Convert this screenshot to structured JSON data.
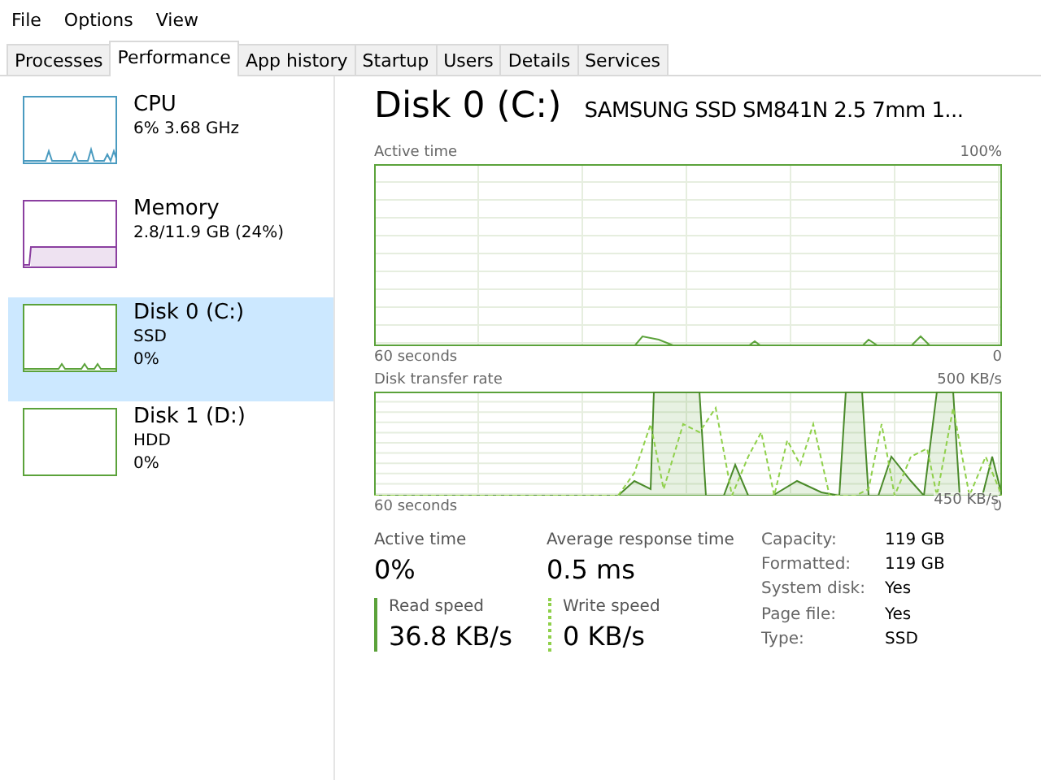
{
  "menu": [
    "File",
    "Options",
    "View"
  ],
  "tabs": [
    {
      "label": "Processes",
      "selected": false
    },
    {
      "label": "Performance",
      "selected": true
    },
    {
      "label": "App history",
      "selected": false
    },
    {
      "label": "Startup",
      "selected": false
    },
    {
      "label": "Users",
      "selected": false
    },
    {
      "label": "Details",
      "selected": false
    },
    {
      "label": "Services",
      "selected": false
    }
  ],
  "sidebar": {
    "items": [
      {
        "kind": "cpu",
        "name": "CPU",
        "lines": [
          "6% 3.68 GHz"
        ],
        "color": "#4a9bc0",
        "selected": false
      },
      {
        "kind": "memory",
        "name": "Memory",
        "lines": [
          "2.8/11.9 GB (24%)"
        ],
        "color": "#8b3fa0",
        "selected": false
      },
      {
        "kind": "disk",
        "name": "Disk 0 (C:)",
        "lines": [
          "SSD",
          "0%"
        ],
        "color": "#5ba23a",
        "selected": true
      },
      {
        "kind": "disk-idle",
        "name": "Disk 1 (D:)",
        "lines": [
          "HDD",
          "0%"
        ],
        "color": "#5ba23a",
        "selected": false
      }
    ]
  },
  "detail": {
    "title": "Disk 0 (C:)",
    "model": "SAMSUNG SSD SM841N 2.5 7mm 1...",
    "graphs": [
      {
        "kind": "active",
        "label": "Active time",
        "max": "100%",
        "span": "60 seconds",
        "min": "0"
      },
      {
        "kind": "transfer",
        "label": "Disk transfer rate",
        "max": "500 KB/s",
        "inner": "450 KB/s",
        "span": "60 seconds",
        "min": "0"
      }
    ],
    "stats": [
      {
        "label": "Active time",
        "value": "0%"
      },
      {
        "label": "Average response time",
        "value": "0.5 ms"
      }
    ],
    "speeds": [
      {
        "kind": "read",
        "label": "Read speed",
        "value": "36.8 KB/s"
      },
      {
        "kind": "write",
        "label": "Write speed",
        "value": "0 KB/s"
      }
    ],
    "properties": [
      {
        "key": "Capacity:",
        "value": "119 GB"
      },
      {
        "key": "Formatted:",
        "value": "119 GB"
      },
      {
        "key": "System disk:",
        "value": "Yes"
      },
      {
        "key": "Page file:",
        "value": "Yes"
      },
      {
        "key": "Type:",
        "value": "SSD"
      }
    ]
  }
}
